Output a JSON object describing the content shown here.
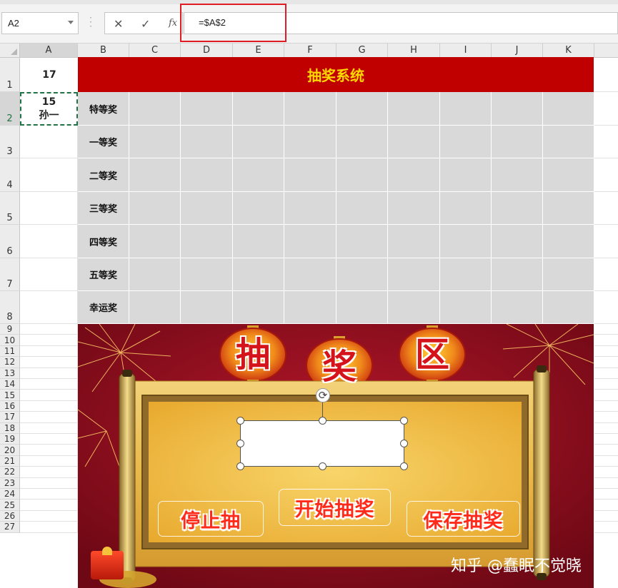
{
  "formula_bar": {
    "name_box": "A2",
    "cancel_icon": "cancel-icon",
    "enter_icon": "check-icon",
    "function_label": "fx",
    "formula": "=$A$2"
  },
  "columns": [
    "A",
    "B",
    "C",
    "D",
    "E",
    "F",
    "G",
    "H",
    "I",
    "J",
    "K"
  ],
  "rows": [
    "1",
    "2",
    "3",
    "4",
    "5",
    "6",
    "7",
    "8",
    "9",
    "10",
    "11",
    "12",
    "13",
    "14",
    "15",
    "16",
    "17",
    "18",
    "19",
    "20",
    "21",
    "22",
    "23",
    "24",
    "25",
    "26",
    "27"
  ],
  "cells": {
    "a1": "17",
    "a2_line1": "15",
    "a2_line2": "孙一",
    "title": "抽奖系统"
  },
  "prizes": [
    "特等奖",
    "一等奖",
    "二等奖",
    "三等奖",
    "四等奖",
    "五等奖",
    "幸运奖"
  ],
  "banner": {
    "lanterns": [
      "抽",
      "奖",
      "区"
    ],
    "buttons": {
      "stop": "停止抽",
      "start": "开始抽奖",
      "save": "保存抽奖"
    }
  },
  "watermark": "知乎 @蠢眠不觉晓",
  "colors": {
    "title_bg": "#c00000",
    "title_text": "#ffd700",
    "prize_bg": "#d9d9d9",
    "highlight": "#e11b22",
    "selection": "#217346"
  }
}
